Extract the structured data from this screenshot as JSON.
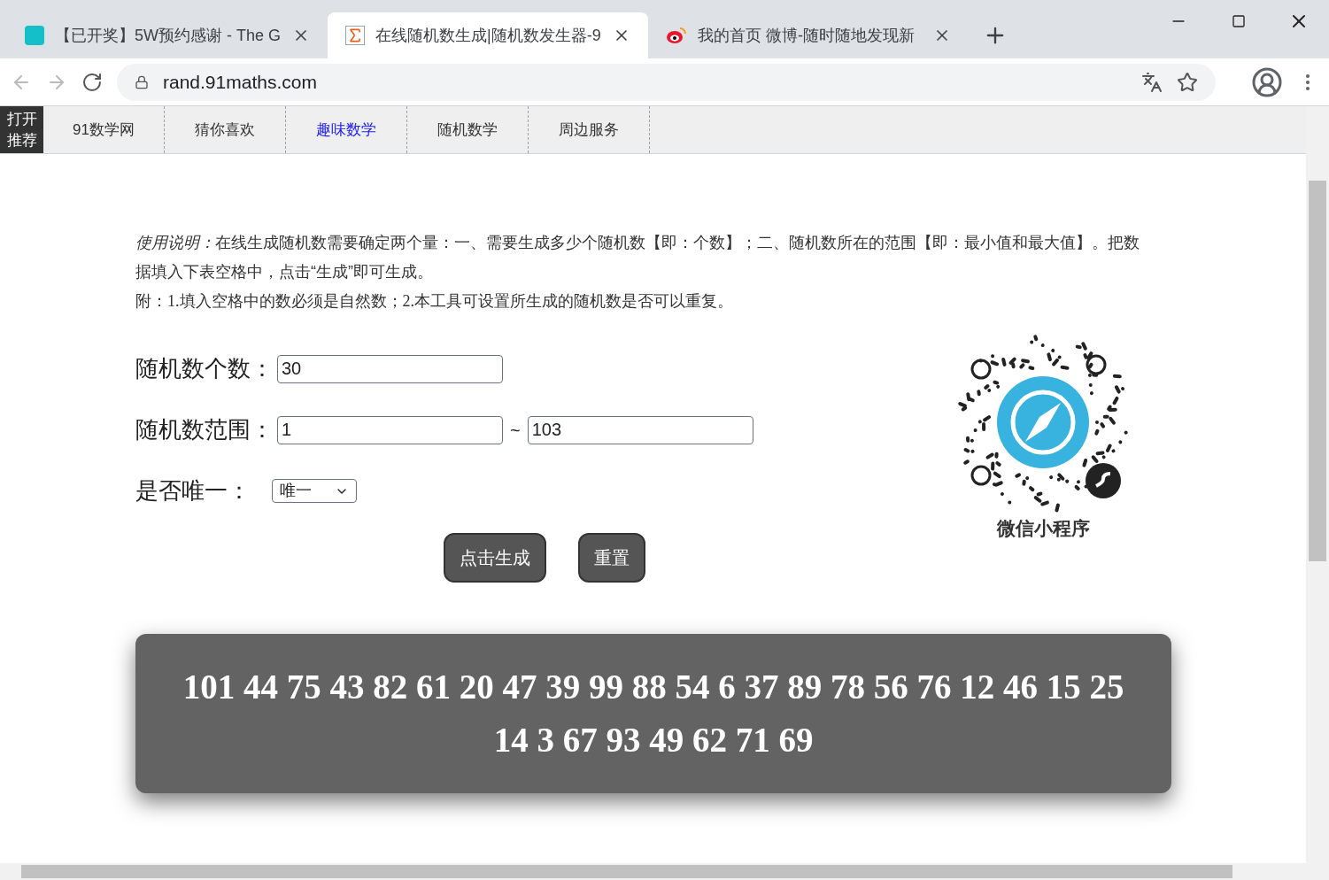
{
  "browser": {
    "tabs": [
      {
        "kind": "tap",
        "title": "【已开奖】5W预约感谢 - The G",
        "selected": false
      },
      {
        "kind": "sigma",
        "title": "在线随机数生成|随机数发生器-9",
        "selected": true
      },
      {
        "kind": "weibo",
        "title": "我的首页 微博-随时随地发现新",
        "selected": false
      }
    ],
    "url": "rand.91maths.com"
  },
  "nav": {
    "toggle": "打开推荐",
    "items": [
      {
        "label": "91数学网",
        "selected": false
      },
      {
        "label": "猜你喜欢",
        "selected": false
      },
      {
        "label": "趣味数学",
        "selected": true
      },
      {
        "label": "随机数学",
        "selected": false
      },
      {
        "label": "周边服务",
        "selected": false
      }
    ]
  },
  "instructions": {
    "lead": "使用说明：",
    "text": "在线生成随机数需要确定两个量：一、需要生成多少个随机数【即：个数】；二、随机数所在的范围【即：最小值和最大值】。把数据填入下表空格中，点击“生成”即可生成。",
    "note": "附：1.填入空格中的数必须是自然数；2.本工具可设置所生成的随机数是否可以重复。"
  },
  "form": {
    "count_label": "随机数个数：",
    "count": "30",
    "range_label": "随机数范围：",
    "min": "1",
    "separator": "~",
    "max": "103",
    "unique_label": "是否唯一：",
    "unique": "唯一",
    "generate": "点击生成",
    "reset": "重置"
  },
  "qr": {
    "caption": "微信小程序"
  },
  "result": "101 44 75 43 82 61 20 47 39 99 88 54 6 37 89 78 56 76 12 46 15 25 14 3 67 93 49 62 71 69"
}
